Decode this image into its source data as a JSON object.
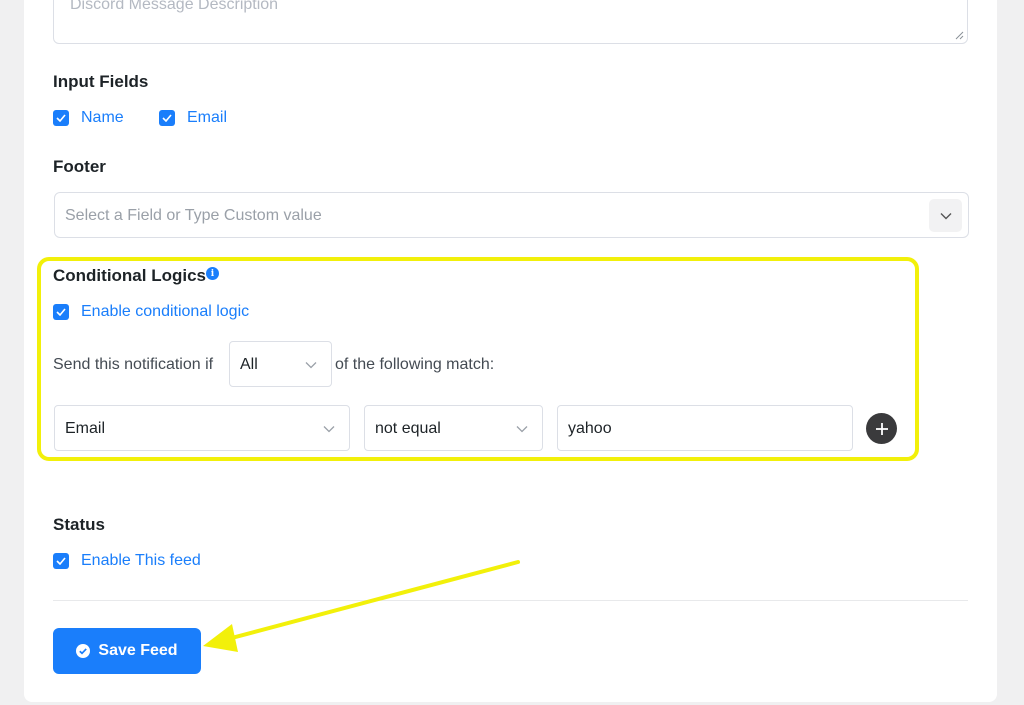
{
  "description_field": {
    "placeholder": "Discord Message Description"
  },
  "input_fields": {
    "label": "Input Fields",
    "options": [
      {
        "label": "Name",
        "checked": true
      },
      {
        "label": "Email",
        "checked": true
      }
    ]
  },
  "footer": {
    "label": "Footer",
    "placeholder": "Select a Field or Type Custom value"
  },
  "conditional_logics": {
    "label": "Conditional Logics",
    "info_icon": "info-icon",
    "enable_label": "Enable conditional logic",
    "enabled": true,
    "sentence_prefix": "Send this notification if",
    "match_type": "All",
    "sentence_suffix": "of the following match:",
    "rule": {
      "field": "Email",
      "operator": "not equal",
      "value": "yahoo"
    },
    "add_icon": "plus-circle-icon"
  },
  "status": {
    "label": "Status",
    "enable_label": "Enable This feed",
    "enabled": true
  },
  "save_button": {
    "label": "Save Feed",
    "icon": "check-circle-icon"
  },
  "colors": {
    "accent": "#1a7efb",
    "highlight": "#f2f00a",
    "background": "#f0f0f1"
  }
}
